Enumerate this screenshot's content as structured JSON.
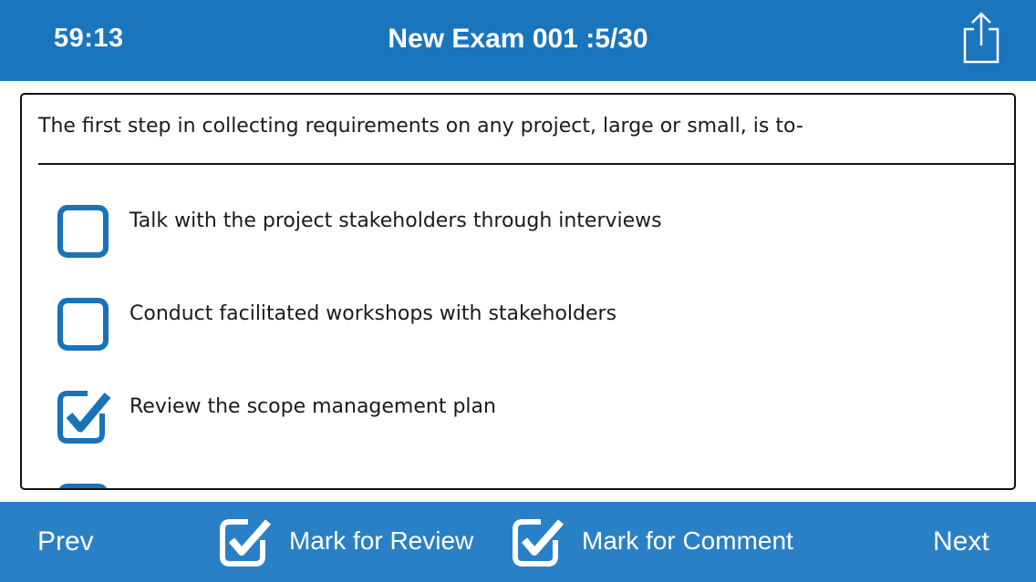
{
  "header": {
    "timer": "59:13",
    "title": "New Exam 001 :5/30",
    "share_icon": "share-icon"
  },
  "question": {
    "text": "The first step in collecting requirements on any project, large or small, is to-",
    "options": [
      {
        "label": "Talk with the project stakeholders through interviews",
        "checked": false
      },
      {
        "label": "Conduct facilitated workshops with stakeholders",
        "checked": false
      },
      {
        "label": "Review the scope management plan",
        "checked": true
      }
    ]
  },
  "footer": {
    "prev_label": "Prev",
    "mark_review_label": "Mark for Review",
    "mark_comment_label": "Mark for Comment",
    "next_label": "Next",
    "mark_review_checked": true,
    "mark_comment_checked": true
  },
  "colors": {
    "header_bg": "#1a75bc",
    "footer_bg": "#2a80c6",
    "checkbox_blue": "#1a72b8",
    "text": "#1a1a1a"
  }
}
